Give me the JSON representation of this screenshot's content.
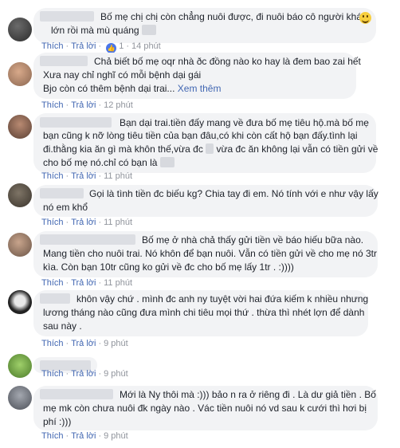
{
  "ui": {
    "like_label": "Thích",
    "reply_label": "Trả lời",
    "see_more_label": "Xem thêm",
    "like_icon": "thumbs-up-icon",
    "emoji_icon": "smiling-face-icon",
    "accent": "#4267b2",
    "bubble_bg": "#f2f3f5"
  },
  "comments": [
    {
      "lines": [
        "Bố mẹ chị chị còn chẳng nuôi được, đi nuôi báo cô người khác",
        "lớn rồi mà mù quáng"
      ],
      "reaction_count": "1",
      "time": "14 phút"
    },
    {
      "lines": [
        "Chả biết bố mẹ oqr nhà ðc đồng nào ko hay là đem bao zai hết",
        "Xưa nay chỉ nghĩ có mỗi bệnh dại gái",
        "Bjo còn có thêm bệnh dại trai..."
      ],
      "time": "12 phút"
    },
    {
      "lines": [
        "Bạn dại trai.tiền đấy mang về đưa bố mẹ tiêu hộ.mà bố mẹ",
        "bạn cũng k nỡ lòng tiêu tiền của bạn đâu,có khi còn cất hộ bạn đấy.tình lại",
        "đi.thằng kia ăn gì mà khôn thế,vừa đc",
        "vừa đc ăn không lại vẫn có tiền gửi về",
        "cho bố mẹ nó.chỉ có bạn là"
      ],
      "time": "11 phút"
    },
    {
      "lines": [
        "Gọi là tình tiền đc biếu kg? Chia tay đi em. Nó tính với e như vậy lấy",
        "nó em khổ"
      ],
      "time": "11 phút"
    },
    {
      "lines": [
        "Bố mẹ ở nhà chả thấy gửi tiền về báo hiếu bữa nào.",
        "Mang tiền cho nuôi trai. Nó khôn để bạn nuôi. Vẫn có tiền gửi về cho mẹ nó 3tr",
        "kìa. Còn bạn 10tr cũng ko gửi về đc cho bố mẹ lấy 1tr . :))))"
      ],
      "time": "11 phút"
    },
    {
      "lines": [
        "khôn vậy chứ . mình đc anh ny tuyệt vời hai đứa kiếm k nhiều nhưng",
        "lương tháng nào cũng đưa mình chi tiêu mọi thứ . thừa thì nhét lợn để dành",
        "sau này ."
      ],
      "time": "9 phút"
    },
    {
      "lines": [],
      "time": "9 phút"
    },
    {
      "lines": [
        "Mới là Ny thôi mà :))) bảo n ra ở riêng đi . Là dư giả tiền . Bố",
        "mẹ mk còn chưa nuôi đk ngày nào . Vác tiền nuôi nó vd sau k cưới thì hơi bị",
        "phí :)))"
      ],
      "time": "9 phút"
    }
  ]
}
